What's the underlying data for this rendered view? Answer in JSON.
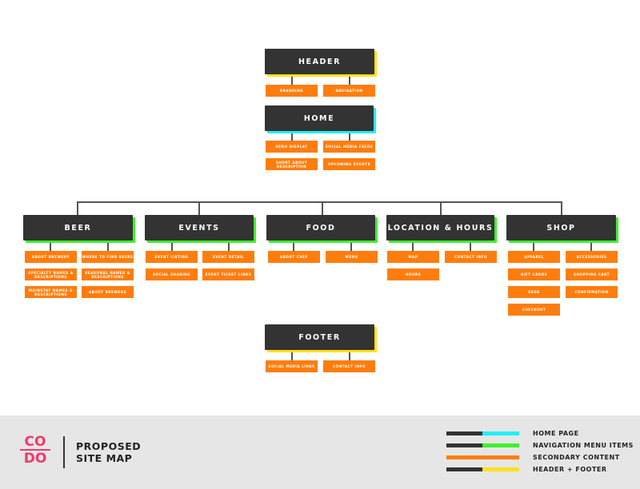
{
  "colors": {
    "node": "#333333",
    "secondary": "#ff7d0d",
    "home": "#1ff0f5",
    "navigation": "#3df22b",
    "header_footer": "#ffe11a",
    "brand": "#f03a6b"
  },
  "header": {
    "label": "HEADER",
    "items": [
      "BRANDING",
      "NAVIGATION"
    ]
  },
  "home": {
    "label": "HOME",
    "items": [
      "HERO DISPLAY",
      "SOCIAL MEDIA FEEDS",
      "SHORT ABOUT DESCRIPTION",
      "UPCOMING EVENTS"
    ]
  },
  "nav": [
    {
      "label": "BEER",
      "items": [
        "ABOUT BREWERY",
        "WHERE TO FIND BEERS",
        "SPECIALTY NAMES & DESCRIPTIONS",
        "SEASONAL NAMES & DESCRIPTIONS",
        "MAINSTAY NAMES & DESCRIPTIONS",
        "ABOUT BREWERS"
      ]
    },
    {
      "label": "EVENTS",
      "items": [
        "EVENT LISTING",
        "EVENT DETAIL",
        "SOCIAL SHARING",
        "EVENT TICKET LINKS"
      ]
    },
    {
      "label": "FOOD",
      "items": [
        "ABOUT CHEF",
        "MENU"
      ]
    },
    {
      "label": "LOCATION & HOURS",
      "items": [
        "MAP",
        "CONTACT INFO",
        "HOURS"
      ]
    },
    {
      "label": "SHOP",
      "items": [
        "APPAREL",
        "ACCESSORIES",
        "GIFT CARDS",
        "SHOPPING CART",
        "KEGS",
        "CONFIRMATION",
        "CHECKOUT"
      ]
    }
  ],
  "footer": {
    "label": "FOOTER",
    "items": [
      "SOCIAL MEDIA LINKS",
      "CONTACT INFO"
    ]
  },
  "brand": {
    "logo_top": "CO",
    "logo_bottom": "DO",
    "title_line1": "PROPOSED",
    "title_line2": "SITE MAP"
  },
  "legend": [
    {
      "label": "HOME PAGE",
      "left": "#333333",
      "right": "#1ff0f5"
    },
    {
      "label": "NAVIGATION MENU ITEMS",
      "left": "#333333",
      "right": "#3df22b"
    },
    {
      "label": "SECONDARY CONTENT",
      "left": "#ff7d0d",
      "right": "#ff7d0d"
    },
    {
      "label": "HEADER + FOOTER",
      "left": "#333333",
      "right": "#ffe11a"
    }
  ]
}
